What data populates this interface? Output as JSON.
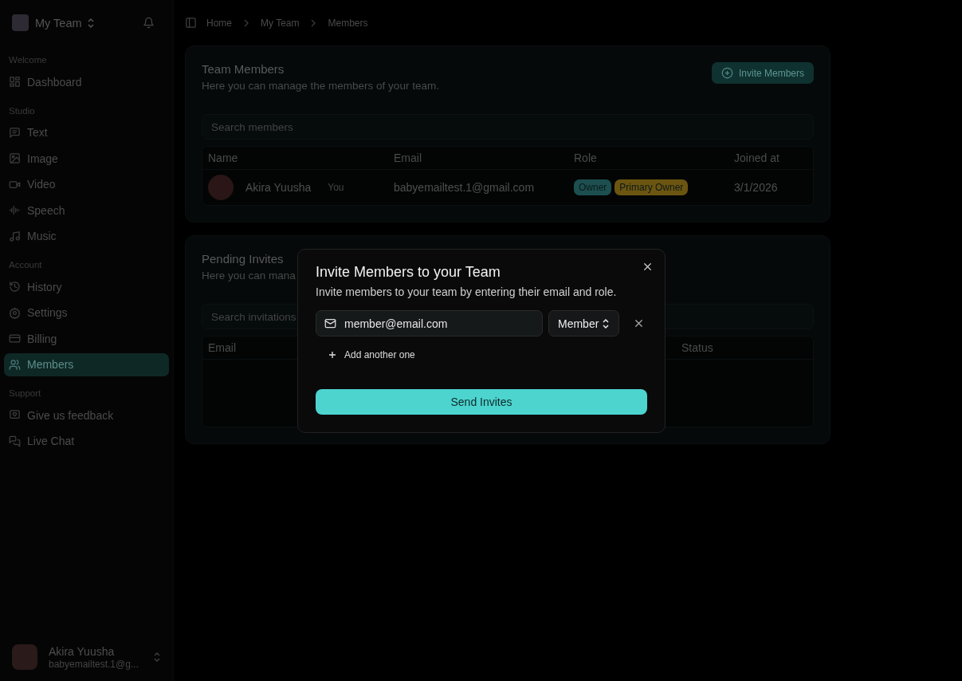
{
  "team": {
    "name": "My Team"
  },
  "breadcrumbs": [
    "Home",
    "My Team",
    "Members"
  ],
  "sidebar": {
    "sections": [
      {
        "label": "Welcome",
        "items": [
          {
            "label": "Dashboard",
            "selected": false
          }
        ]
      },
      {
        "label": "Studio",
        "items": [
          {
            "label": "Text",
            "selected": false
          },
          {
            "label": "Image",
            "selected": false
          },
          {
            "label": "Video",
            "selected": false
          },
          {
            "label": "Speech",
            "selected": false
          },
          {
            "label": "Music",
            "selected": false
          }
        ]
      },
      {
        "label": "Account",
        "items": [
          {
            "label": "History",
            "selected": false
          },
          {
            "label": "Settings",
            "selected": false
          },
          {
            "label": "Billing",
            "selected": false
          },
          {
            "label": "Members",
            "selected": true
          }
        ]
      },
      {
        "label": "Support",
        "items": [
          {
            "label": "Give us feedback",
            "selected": false
          },
          {
            "label": "Live Chat",
            "selected": false
          }
        ]
      }
    ],
    "user": {
      "name": "Akira Yuusha",
      "email": "babyemailtest.1@g..."
    }
  },
  "members": {
    "title": "Team Members",
    "subtitle": "Here you can manage the members of your team.",
    "invite_button": "Invite Members",
    "search": {
      "placeholder": "Search members"
    },
    "columns": [
      "Name",
      "Email",
      "Role",
      "Joined at"
    ],
    "rows": [
      {
        "name": "Akira Yuusha",
        "tag": "You",
        "email": "babyemailtest.1@gmail.com",
        "roles": [
          {
            "label": "Owner",
            "color": "#1d4f50"
          },
          {
            "label": "Primary Owner",
            "color": "#6b5510"
          }
        ],
        "joined": "3/1/2026"
      }
    ]
  },
  "invites": {
    "title": "Pending Invites",
    "subtitle": "Here you can mana",
    "search": {
      "placeholder": "Search invitations"
    },
    "columns": [
      "Email",
      "Status"
    ]
  },
  "dialog": {
    "title": "Invite Members to your Team",
    "description": "Invite members to your team by entering their email and role.",
    "email": {
      "value": "member@email.com"
    },
    "role": {
      "value": "Member"
    },
    "add_label": "Add another one",
    "submit": "Send Invites"
  }
}
